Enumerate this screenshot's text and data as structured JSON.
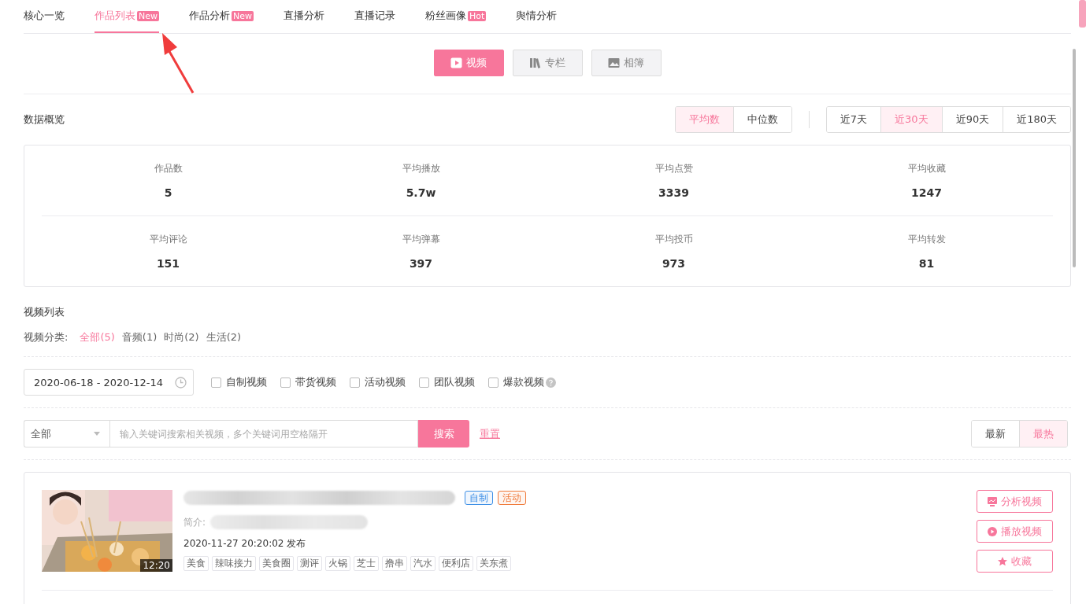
{
  "tabs": [
    {
      "label": "核心一览",
      "selected": false
    },
    {
      "label": "作品列表",
      "badge": "New",
      "selected": true
    },
    {
      "label": "作品分析",
      "badge": "New",
      "selected": false
    },
    {
      "label": "直播分析",
      "selected": false
    },
    {
      "label": "直播记录",
      "selected": false
    },
    {
      "label": "粉丝画像",
      "badge": "Hot",
      "selected": false
    },
    {
      "label": "舆情分析",
      "selected": false
    }
  ],
  "annotation": {
    "kind": "arrow"
  },
  "media_types": [
    {
      "label": "视频",
      "selected": true
    },
    {
      "label": "专栏",
      "selected": false
    },
    {
      "label": "相簿",
      "selected": false
    }
  ],
  "overview": {
    "title": "数据概览",
    "stat_modes": [
      {
        "label": "平均数",
        "selected": true
      },
      {
        "label": "中位数",
        "selected": false
      }
    ],
    "periods": [
      {
        "label": "近7天",
        "selected": false
      },
      {
        "label": "近30天",
        "selected": true
      },
      {
        "label": "近90天",
        "selected": false
      },
      {
        "label": "近180天",
        "selected": false
      }
    ],
    "stats": [
      {
        "label": "作品数",
        "value": "5"
      },
      {
        "label": "平均播放",
        "value": "5.7w"
      },
      {
        "label": "平均点赞",
        "value": "3339"
      },
      {
        "label": "平均收藏",
        "value": "1247"
      },
      {
        "label": "平均评论",
        "value": "151"
      },
      {
        "label": "平均弹幕",
        "value": "397"
      },
      {
        "label": "平均投币",
        "value": "973"
      },
      {
        "label": "平均转发",
        "value": "81"
      }
    ]
  },
  "video_list": {
    "title": "视频列表",
    "category_label": "视频分类:",
    "categories": [
      {
        "label": "全部(5)",
        "selected": true
      },
      {
        "label": "音频(1)",
        "selected": false
      },
      {
        "label": "时尚(2)",
        "selected": false
      },
      {
        "label": "生活(2)",
        "selected": false
      }
    ],
    "date_range": "2020-06-18 - 2020-12-14",
    "filters": [
      {
        "label": "自制视频",
        "checked": false
      },
      {
        "label": "带货视频",
        "checked": false
      },
      {
        "label": "活动视频",
        "checked": false
      },
      {
        "label": "团队视频",
        "checked": false
      },
      {
        "label": "爆款视频",
        "checked": false,
        "help": true
      }
    ],
    "scope": "全部",
    "search_placeholder": "输入关键词搜索相关视频，多个关键词用空格隔开",
    "search_button": "搜索",
    "reset_link": "重置",
    "sorts": [
      {
        "label": "最新",
        "selected": false
      },
      {
        "label": "最热",
        "selected": true
      }
    ],
    "videos": [
      {
        "thumbnail": {
          "kind": "picture"
        },
        "duration": "12:20",
        "title_blurred": true,
        "badges": [
          {
            "label": "自制",
            "color": "#3d8fe6"
          },
          {
            "label": "活动",
            "color": "#f07a3a"
          }
        ],
        "intro_label": "简介:",
        "intro_blurred": true,
        "published": "2020-11-27 20:20:02 发布",
        "tags": [
          "美食",
          "辣味接力",
          "美食圈",
          "测评",
          "火锅",
          "芝士",
          "撸串",
          "汽水",
          "便利店",
          "关东煮"
        ],
        "actions": [
          {
            "label": "分析视频"
          },
          {
            "label": "播放视频"
          },
          {
            "label": "收藏"
          }
        ]
      }
    ]
  }
}
